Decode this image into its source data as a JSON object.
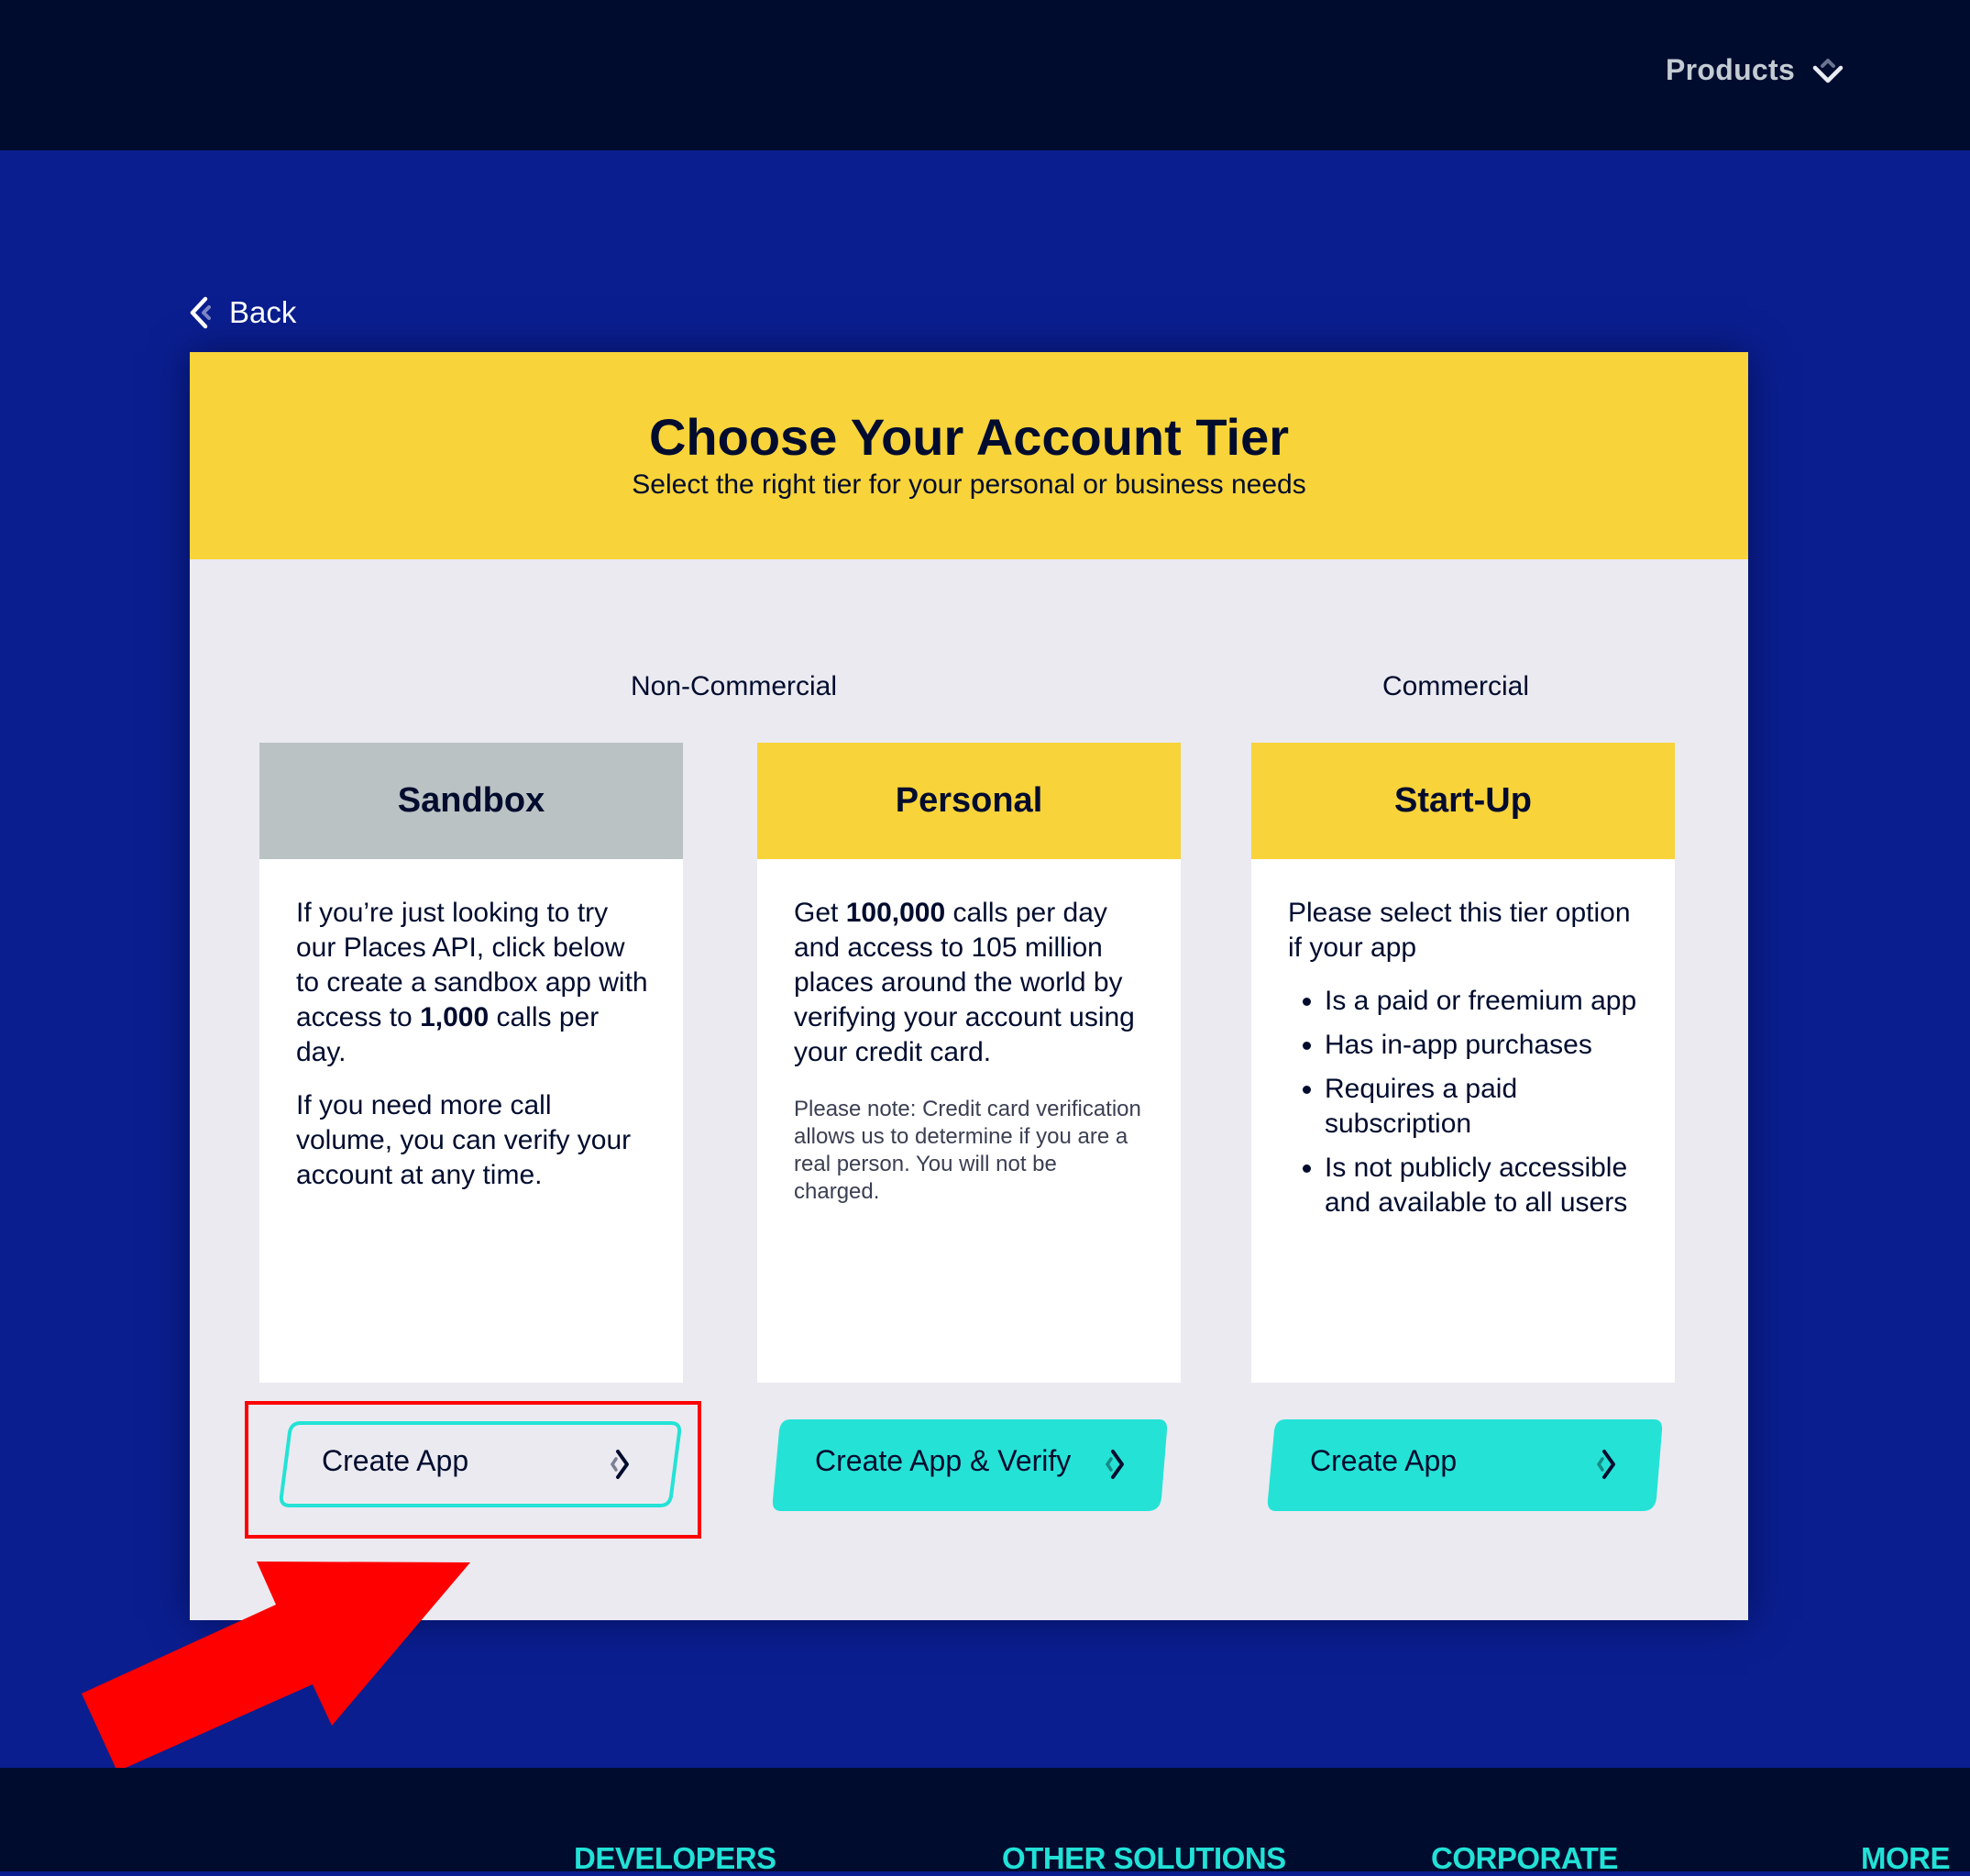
{
  "topbar": {
    "products_label": "Products"
  },
  "back_label": "Back",
  "card": {
    "title": "Choose Your Account Tier",
    "subtitle": "Select the right tier for your personal or business needs",
    "groups": {
      "non_commercial": "Non-Commercial",
      "commercial": "Commercial"
    },
    "tiers": [
      {
        "name": "Sandbox",
        "header_color": "#bac2c4",
        "paragraphs": [
          {
            "before": "If you’re just looking to try our Places API, click below to create a sandbox app with access to ",
            "bold": "1,000",
            "after": " calls per day."
          },
          {
            "before": "If you need more call volume, you can verify your account at any time.",
            "bold": "",
            "after": ""
          }
        ],
        "button_label": "Create App",
        "button_style": "outline"
      },
      {
        "name": "Personal",
        "header_color": "#f8d33a",
        "paragraphs": [
          {
            "before": "Get ",
            "bold": "100,000",
            "after": " calls per day and access to 105 million places around the world by verifying your account using your credit card."
          }
        ],
        "note": "Please note: Credit card verification allows us to determine if you are a real person. You will not be charged.",
        "button_label": "Create App & Verify",
        "button_style": "filled"
      },
      {
        "name": "Start-Up",
        "header_color": "#f8d33a",
        "intro": "Please select this tier option if your app",
        "bullets": [
          "Is a paid or freemium app",
          "Has in-app purchases",
          "Requires a paid subscription",
          "Is not publicly accessible and available to all users"
        ],
        "button_label": "Create App",
        "button_style": "filled"
      }
    ]
  },
  "annotation": {
    "highlight_color": "#ff0000",
    "target": "Sandbox Create App button"
  },
  "footer": {
    "headings": [
      "DEVELOPERS",
      "OTHER SOLUTIONS",
      "CORPORATE",
      "MORE"
    ]
  },
  "colors": {
    "navy": "#000c2e",
    "blue": "#0a1e8f",
    "yellow": "#f8d33a",
    "teal": "#25e2d6",
    "panel": "#ebeaf0"
  }
}
